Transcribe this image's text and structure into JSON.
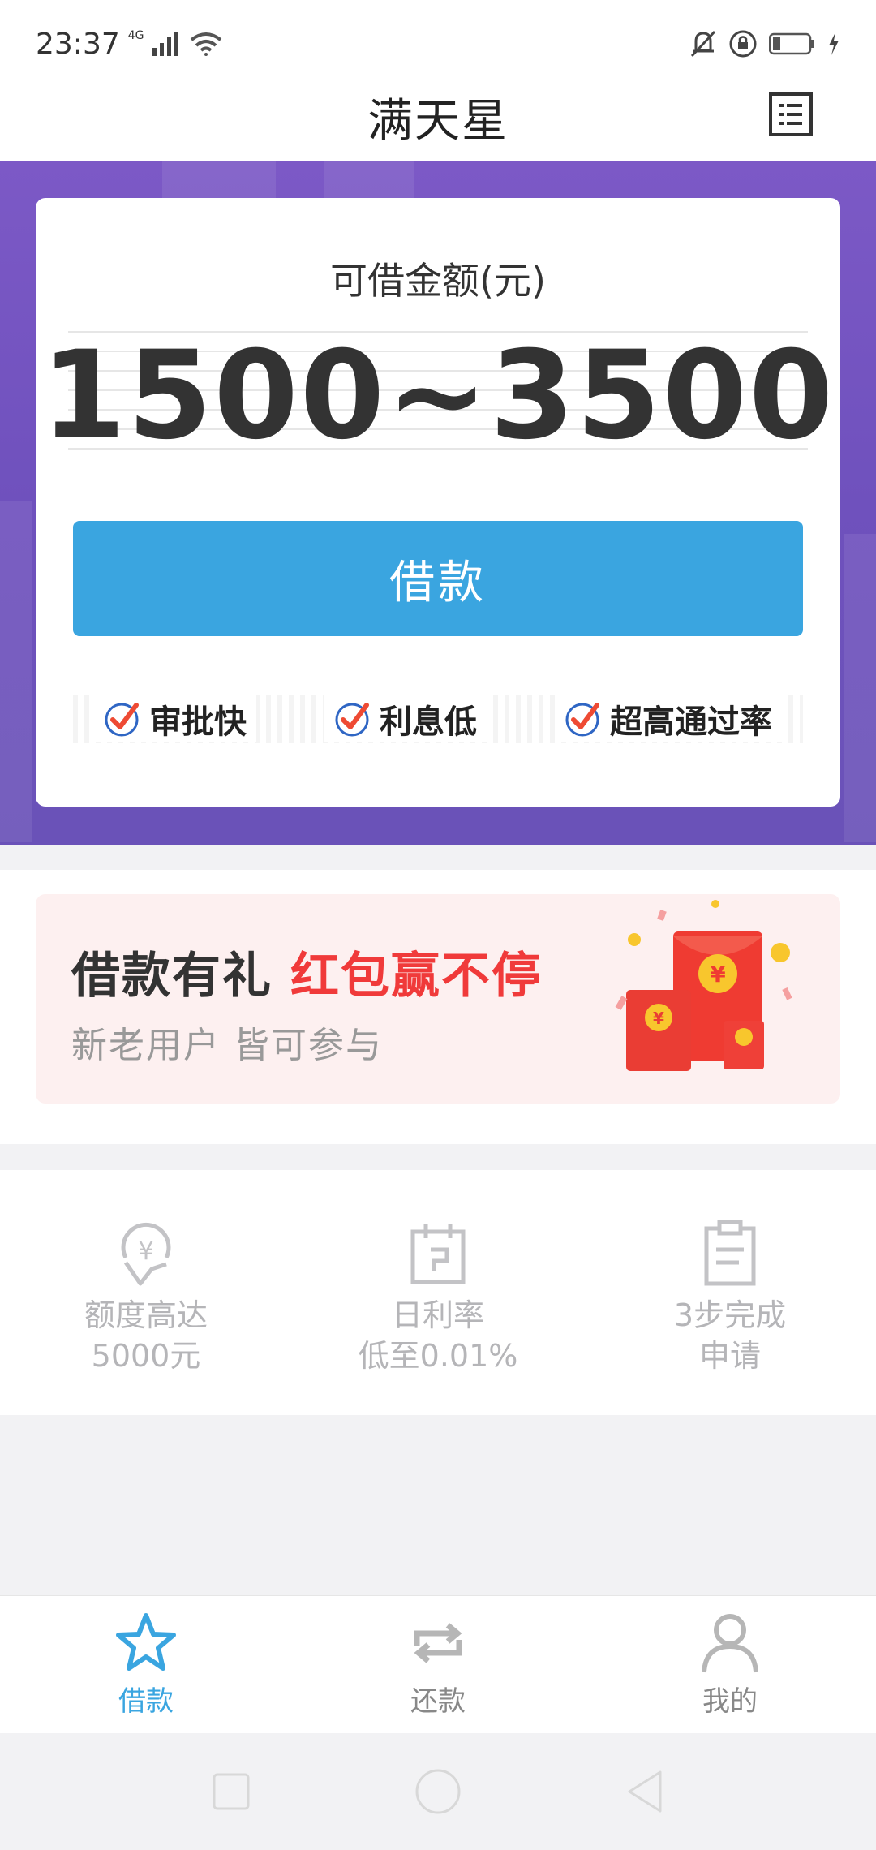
{
  "status_bar": {
    "time": "23:37",
    "network": "4G",
    "icons": [
      "signal-icon",
      "wifi-icon",
      "bell-muted-icon",
      "lock-rotation-icon",
      "battery-icon",
      "charging-icon"
    ]
  },
  "header": {
    "title": "满天星",
    "menu_icon": "list-icon"
  },
  "loan_card": {
    "label": "可借金额(元)",
    "amount": "1500~3500",
    "borrow_button": "借款",
    "features": [
      "审批快",
      "利息低",
      "超高通过率"
    ],
    "feature_icon": "check-circle-icon"
  },
  "promo": {
    "title": "借款有礼",
    "highlight": "红包赢不停",
    "subtitle": "新老用户 皆可参与",
    "image": "red-envelopes-illustration"
  },
  "benefits": [
    {
      "icon": "yuan-badge-icon",
      "line1": "额度高达",
      "line2": "5000元"
    },
    {
      "icon": "calendar-icon",
      "line1": "日利率",
      "line2": "低至0.01%"
    },
    {
      "icon": "clipboard-icon",
      "line1": "3步完成",
      "line2": "申请"
    }
  ],
  "bottom_nav": {
    "items": [
      {
        "label": "借款",
        "icon": "star-icon",
        "active": true
      },
      {
        "label": "还款",
        "icon": "repeat-icon",
        "active": false
      },
      {
        "label": "我的",
        "icon": "person-icon",
        "active": false
      }
    ]
  },
  "colors": {
    "accent": "#3aa5e0",
    "hero_purple": "#7359c0",
    "promo_red": "#f03a3a"
  }
}
